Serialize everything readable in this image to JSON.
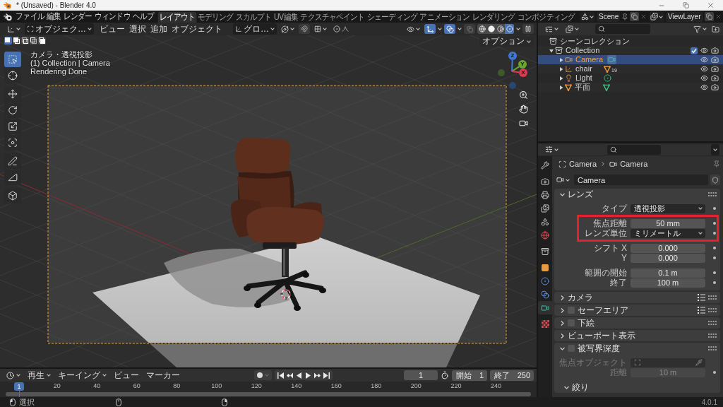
{
  "window": {
    "title": "* (Unsaved) - Blender 4.0"
  },
  "top_bar": {
    "menus": [
      "ファイル",
      "編集",
      "レンダー",
      "ウィンドウ",
      "ヘルプ"
    ],
    "workspaces": [
      {
        "label": "レイアウト",
        "selected": true
      },
      {
        "label": "モデリング",
        "selected": false
      },
      {
        "label": "スカルプト",
        "selected": false
      },
      {
        "label": "UV編集",
        "selected": false
      },
      {
        "label": "テクスチャペイント",
        "selected": false
      },
      {
        "label": "シェーディング",
        "selected": false
      },
      {
        "label": "アニメーション",
        "selected": false
      },
      {
        "label": "レンダリング",
        "selected": false
      },
      {
        "label": "コンポジティング",
        "selected": false
      }
    ],
    "scene": "Scene",
    "view_layer": "ViewLayer"
  },
  "viewport": {
    "header": {
      "mode": "オブジェク…",
      "menus": [
        "ビュー",
        "選択",
        "追加",
        "オブジェクト"
      ],
      "orientation": "グロ…",
      "snap": false,
      "gizmos": true,
      "overlays": true,
      "xray": false,
      "shading": [
        {
          "kind": "wireframe",
          "selected": false
        },
        {
          "kind": "solid",
          "selected": false
        },
        {
          "kind": "material",
          "selected": false
        },
        {
          "kind": "rendered",
          "selected": true
        }
      ]
    },
    "select_modes": [
      {
        "kind": "set",
        "selected": true
      },
      {
        "kind": "extend",
        "selected": false
      },
      {
        "kind": "subtract",
        "selected": false
      },
      {
        "kind": "invert",
        "selected": false
      },
      {
        "kind": "intersect",
        "selected": false
      }
    ],
    "options": "オプション",
    "tool_groups": [
      {
        "tools": [
          {
            "kind": "select_box",
            "selected": true
          },
          {
            "kind": "cursor",
            "selected": false
          }
        ]
      },
      {
        "tools": [
          {
            "kind": "move",
            "selected": false
          },
          {
            "kind": "rotate",
            "selected": false
          },
          {
            "kind": "scale",
            "selected": false
          },
          {
            "kind": "transform",
            "selected": false
          }
        ]
      },
      {
        "tools": [
          {
            "kind": "annotate",
            "selected": false
          },
          {
            "kind": "measure",
            "selected": false
          }
        ]
      },
      {
        "tools": [
          {
            "kind": "add_cube",
            "selected": false
          }
        ]
      }
    ],
    "info": [
      "カメラ・透視投影",
      "(1) Collection | Camera",
      "Rendering Done"
    ],
    "axes": [
      {
        "label": "Z",
        "color": "#3f78d9"
      },
      {
        "label": "Y",
        "color": "#6aa72f"
      },
      {
        "label": "X",
        "color": "#e0384f"
      }
    ]
  },
  "outliner": {
    "tree": [
      {
        "name": "シーンコレクション",
        "kind": "scene_collection",
        "selected": false,
        "children": [
          {
            "name": "Collection",
            "kind": "collection",
            "selected": false,
            "expanded": true,
            "checked": true,
            "children": [
              {
                "name": "Camera",
                "kind": "camera",
                "selected": true,
                "expanded": false
              },
              {
                "name": "chair",
                "kind": "empty",
                "selected": false,
                "expanded": false,
                "count": "19"
              },
              {
                "name": "Light",
                "kind": "light",
                "selected": false,
                "expanded": false
              },
              {
                "name": "平面",
                "kind": "mesh",
                "selected": false,
                "expanded": false
              }
            ]
          }
        ]
      }
    ]
  },
  "properties": {
    "tab_groups": [
      {
        "tabs": [
          {
            "kind": "tool",
            "selected": false
          }
        ]
      },
      {
        "tabs": [
          {
            "kind": "render",
            "selected": false
          },
          {
            "kind": "output",
            "selected": false
          },
          {
            "kind": "view_layer",
            "selected": false
          },
          {
            "kind": "scene",
            "selected": false
          },
          {
            "kind": "world",
            "selected": false
          }
        ]
      },
      {
        "tabs": [
          {
            "kind": "collection",
            "selected": false
          }
        ]
      },
      {
        "tabs": [
          {
            "kind": "object",
            "selected": false
          },
          {
            "kind": "physics",
            "selected": false
          },
          {
            "kind": "constraints",
            "selected": false
          },
          {
            "kind": "data",
            "selected": true
          }
        ]
      },
      {
        "tabs": [
          {
            "kind": "texture",
            "selected": false
          }
        ]
      }
    ],
    "breadcrumb": [
      "Camera",
      "Camera"
    ],
    "datablock": "Camera",
    "panels": [
      {
        "title": "レンズ",
        "expanded": true,
        "groups": [
          {
            "rows": [
              {
                "label": "タイプ",
                "kind": "dropdown",
                "value": "透視投影",
                "highlighted": false
              }
            ]
          },
          {
            "rows": [
              {
                "label": "焦点距離",
                "kind": "number",
                "value": "50 mm",
                "highlighted": true
              },
              {
                "label": "レンズ単位",
                "kind": "dropdown",
                "value": "ミリメートル",
                "highlighted": true
              }
            ]
          },
          {
            "rows": [
              {
                "label": "シフト X",
                "kind": "number",
                "value": "0.000",
                "highlighted": false
              },
              {
                "label": "Y",
                "kind": "number",
                "value": "0.000",
                "highlighted": false
              }
            ]
          },
          {
            "rows": [
              {
                "label": "範囲の開始",
                "kind": "number",
                "value": "0.1 m",
                "highlighted": false
              },
              {
                "label": "終了",
                "kind": "number",
                "value": "100 m",
                "highlighted": false
              }
            ]
          }
        ]
      },
      {
        "title": "カメラ",
        "expanded": false,
        "presets": true
      },
      {
        "title": "セーフエリア",
        "expanded": false,
        "checked": false,
        "presets": true
      },
      {
        "title": "下絵",
        "expanded": false,
        "checked": false
      },
      {
        "title": "ビューポート表示",
        "expanded": false
      },
      {
        "title": "被写界深度",
        "expanded": true,
        "checked": false,
        "groups": [
          {
            "rows": [
              {
                "label": "焦点オブジェクト",
                "kind": "object",
                "highlighted": false
              },
              {
                "label": "距離",
                "kind": "number",
                "value": "10 m",
                "highlighted": false
              }
            ]
          }
        ],
        "subpanels": [
          {
            "title": "絞り",
            "expanded": true
          }
        ]
      }
    ]
  },
  "timeline": {
    "menus": [
      {
        "label": "再生",
        "dropdown": true
      },
      {
        "label": "キーイング",
        "dropdown": true
      },
      {
        "label": "ビュー",
        "dropdown": false
      },
      {
        "label": "マーカー",
        "dropdown": false
      }
    ],
    "current_frame": "1",
    "start": {
      "label": "開始",
      "value": "1"
    },
    "end": {
      "label": "終了",
      "value": "250"
    },
    "ruler": [
      {
        "label": "1",
        "selected": true
      },
      {
        "label": "20",
        "selected": false
      },
      {
        "label": "40",
        "selected": false
      },
      {
        "label": "60",
        "selected": false
      },
      {
        "label": "80",
        "selected": false
      },
      {
        "label": "100",
        "selected": false
      },
      {
        "label": "120",
        "selected": false
      },
      {
        "label": "140",
        "selected": false
      },
      {
        "label": "160",
        "selected": false
      },
      {
        "label": "180",
        "selected": false
      },
      {
        "label": "200",
        "selected": false
      },
      {
        "label": "220",
        "selected": false
      },
      {
        "label": "240",
        "selected": false
      }
    ]
  },
  "status_bar": {
    "hints": [
      {
        "kind": "mouse_left",
        "label": "選択"
      },
      {
        "kind": "mouse_middle"
      },
      {
        "kind": "mouse_right"
      }
    ],
    "version": "4.0.1"
  }
}
